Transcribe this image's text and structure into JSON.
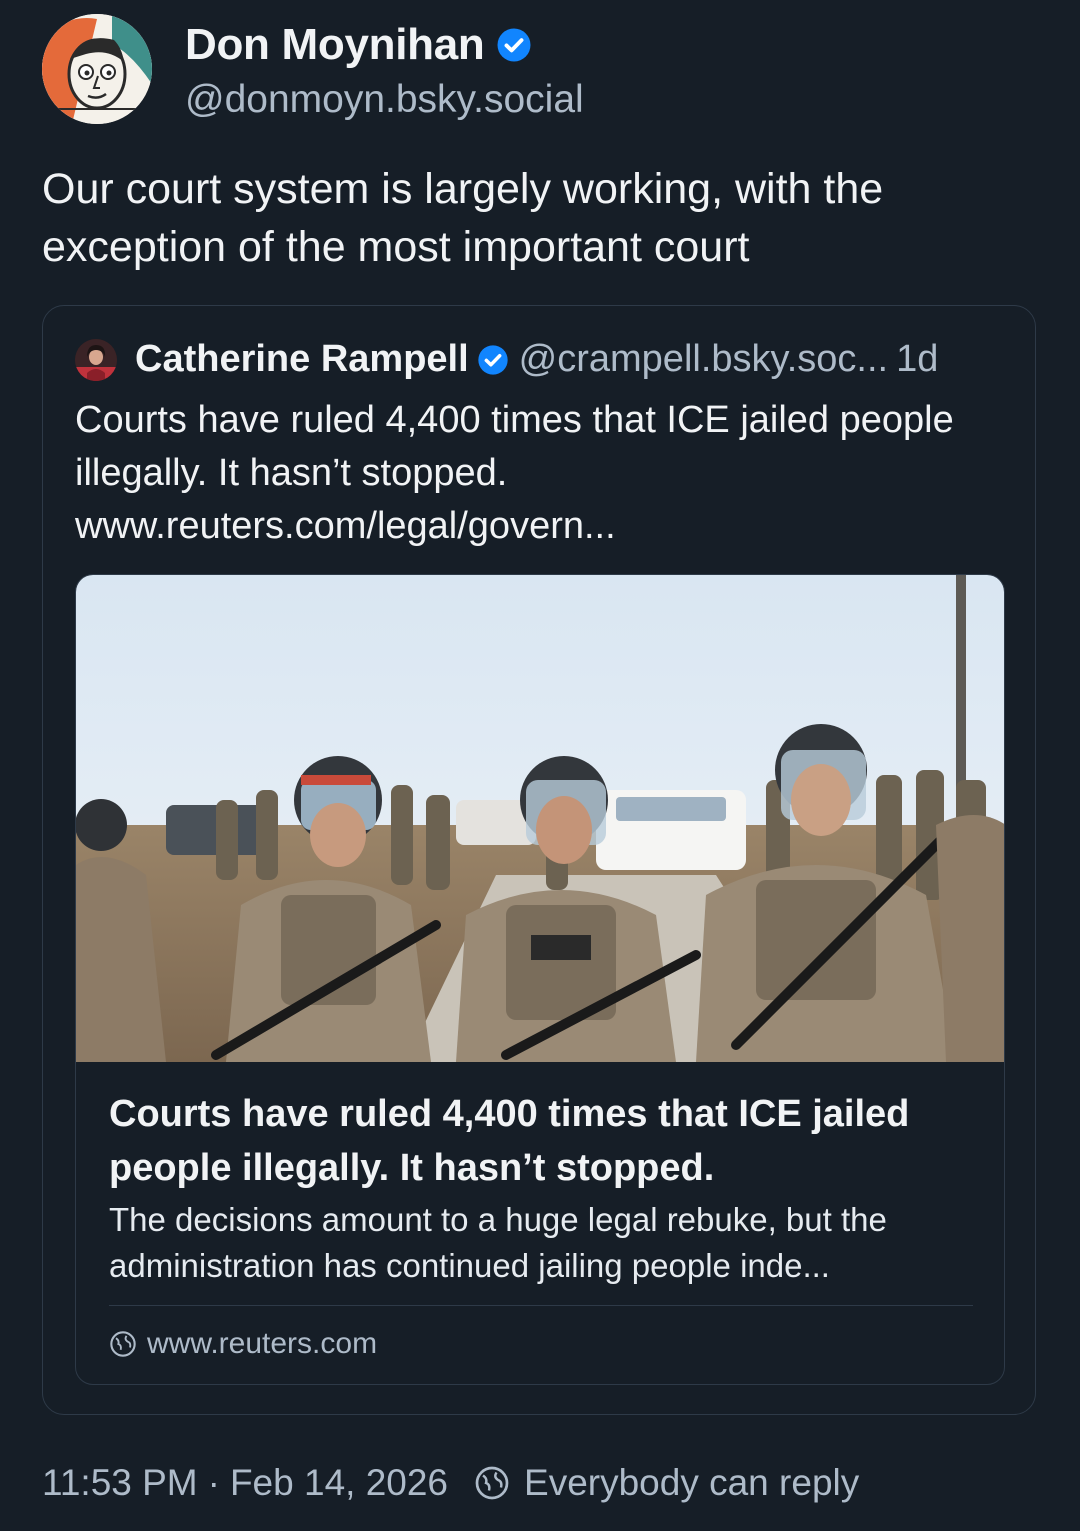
{
  "author": {
    "display_name": "Don Moynihan",
    "handle": "@donmoyn.bsky.social",
    "verified": true
  },
  "post": {
    "text": "Our court system is largely working, with the exception of the most important court"
  },
  "quoted_post": {
    "author_name": "Catherine Rampell",
    "author_handle": "@crampell.bsky.soc...",
    "verified": true,
    "time_ago": "1d",
    "text": "Courts have ruled 4,400 times that ICE jailed people illegally. It hasn’t stopped. www.reuters.com/legal/govern...",
    "link_card": {
      "title": "Courts have ruled 4,400 times that ICE jailed people illegally. It hasn’t stopped.",
      "description": "The decisions amount to a huge legal rebuke, but the administration has continued jailing people inde...",
      "domain": "www.reuters.com",
      "image_icon": "photo-state-troopers"
    }
  },
  "meta": {
    "time": "11:53 PM",
    "separator": "·",
    "date": "Feb 14, 2026",
    "reply_setting": "Everybody can reply"
  },
  "colors": {
    "background": "#161e27",
    "text_primary": "#f1f3f5",
    "text_secondary": "#aebbc9",
    "verified_blue": "#1185fe",
    "border": "#2e3a48"
  }
}
